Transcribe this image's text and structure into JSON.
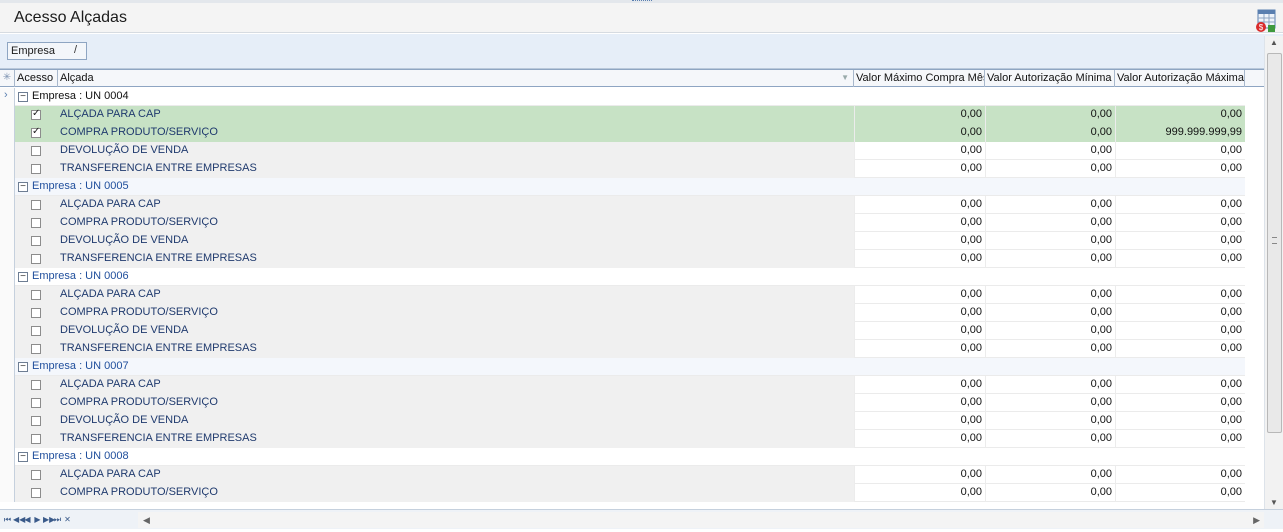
{
  "page": {
    "title": "Acesso Alçadas"
  },
  "group_by": {
    "label": "Empresa",
    "sort_indicator": "/"
  },
  "columns": {
    "acesso": "Acesso",
    "alcada": "Alçada",
    "valor_max_compra_mes": "Valor Máximo Compra Mês",
    "valor_aut_min": "Valor Autorização Mínima",
    "valor_aut_max": "Valor Autorização Máxima"
  },
  "groups": [
    {
      "label": "Empresa : UN 0004",
      "rows": [
        {
          "checked": true,
          "alcada": "ALÇADA PARA CAP",
          "v1": "0,00",
          "v2": "0,00",
          "v3": "0,00"
        },
        {
          "checked": true,
          "alcada": "COMPRA PRODUTO/SERVIÇO",
          "v1": "0,00",
          "v2": "0,00",
          "v3": "999.999.999,99"
        },
        {
          "checked": false,
          "alcada": "DEVOLUÇÃO DE VENDA",
          "v1": "0,00",
          "v2": "0,00",
          "v3": "0,00"
        },
        {
          "checked": false,
          "alcada": "TRANSFERENCIA ENTRE EMPRESAS",
          "v1": "0,00",
          "v2": "0,00",
          "v3": "0,00"
        }
      ]
    },
    {
      "label": "Empresa : UN 0005",
      "rows": [
        {
          "checked": false,
          "alcada": "ALÇADA PARA CAP",
          "v1": "0,00",
          "v2": "0,00",
          "v3": "0,00"
        },
        {
          "checked": false,
          "alcada": "COMPRA PRODUTO/SERVIÇO",
          "v1": "0,00",
          "v2": "0,00",
          "v3": "0,00"
        },
        {
          "checked": false,
          "alcada": "DEVOLUÇÃO DE VENDA",
          "v1": "0,00",
          "v2": "0,00",
          "v3": "0,00"
        },
        {
          "checked": false,
          "alcada": "TRANSFERENCIA ENTRE EMPRESAS",
          "v1": "0,00",
          "v2": "0,00",
          "v3": "0,00"
        }
      ]
    },
    {
      "label": "Empresa : UN 0006",
      "rows": [
        {
          "checked": false,
          "alcada": "ALÇADA PARA CAP",
          "v1": "0,00",
          "v2": "0,00",
          "v3": "0,00"
        },
        {
          "checked": false,
          "alcada": "COMPRA PRODUTO/SERVIÇO",
          "v1": "0,00",
          "v2": "0,00",
          "v3": "0,00"
        },
        {
          "checked": false,
          "alcada": "DEVOLUÇÃO DE VENDA",
          "v1": "0,00",
          "v2": "0,00",
          "v3": "0,00"
        },
        {
          "checked": false,
          "alcada": "TRANSFERENCIA ENTRE EMPRESAS",
          "v1": "0,00",
          "v2": "0,00",
          "v3": "0,00"
        }
      ]
    },
    {
      "label": "Empresa : UN 0007",
      "rows": [
        {
          "checked": false,
          "alcada": "ALÇADA PARA CAP",
          "v1": "0,00",
          "v2": "0,00",
          "v3": "0,00"
        },
        {
          "checked": false,
          "alcada": "COMPRA PRODUTO/SERVIÇO",
          "v1": "0,00",
          "v2": "0,00",
          "v3": "0,00"
        },
        {
          "checked": false,
          "alcada": "DEVOLUÇÃO DE VENDA",
          "v1": "0,00",
          "v2": "0,00",
          "v3": "0,00"
        },
        {
          "checked": false,
          "alcada": "TRANSFERENCIA ENTRE EMPRESAS",
          "v1": "0,00",
          "v2": "0,00",
          "v3": "0,00"
        }
      ]
    },
    {
      "label": "Empresa : UN 0008",
      "rows": [
        {
          "checked": false,
          "alcada": "ALÇADA PARA CAP",
          "v1": "0,00",
          "v2": "0,00",
          "v3": "0,00"
        },
        {
          "checked": false,
          "alcada": "COMPRA PRODUTO/SERVIÇO",
          "v1": "0,00",
          "v2": "0,00",
          "v3": "0,00"
        }
      ]
    }
  ],
  "selected_rows": [
    0,
    1
  ],
  "icons": {
    "report": "report-export-icon",
    "expander": "collapse-minus-icon",
    "checkbox": "checkbox-icon"
  },
  "colors": {
    "selection": "#c7e2c5",
    "group_text": "#1f4e9c",
    "header_border": "#8ea5c2"
  }
}
